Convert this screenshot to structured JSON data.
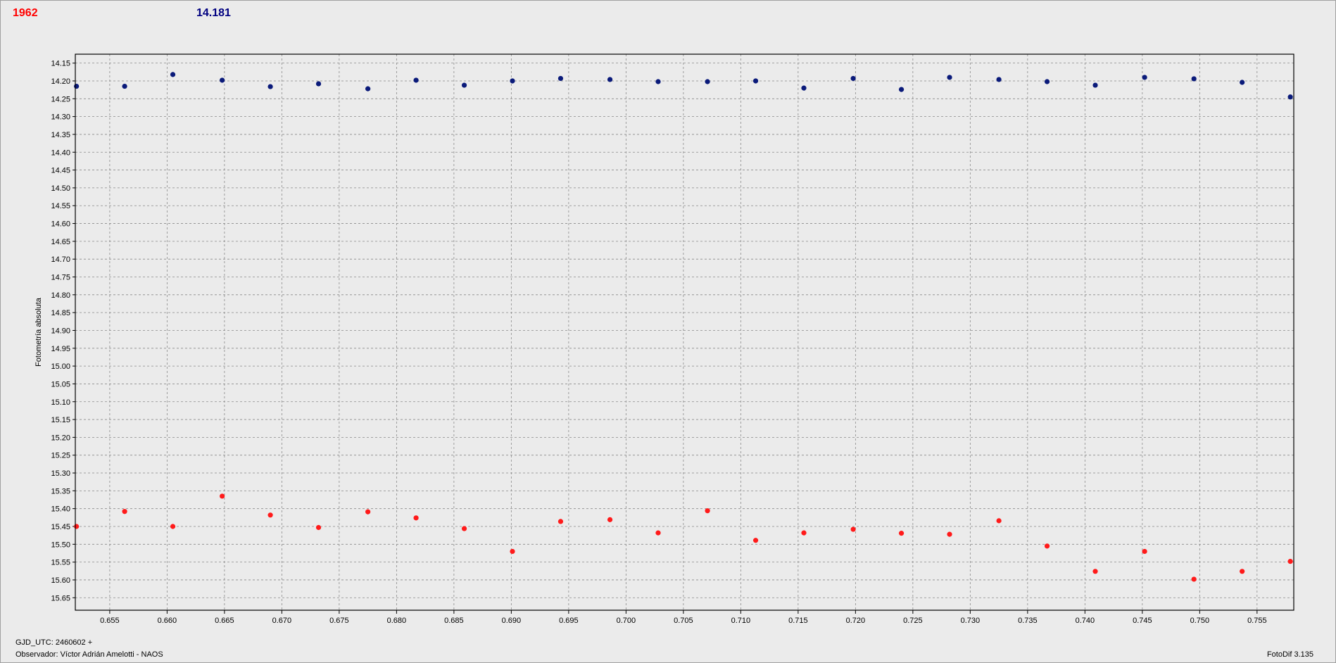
{
  "header": {
    "left_value": "1962",
    "right_value": "14.181"
  },
  "footer": {
    "gjd": "GJD_UTC: 2460602 +",
    "observer": "Observador: Víctor Adrián Amelotti - NAOS",
    "software": "FotoDif 3.135"
  },
  "colors": {
    "series_red": "#ff1a1a",
    "series_blue": "#0a1a7a",
    "header_red": "#ff0000",
    "header_blue": "#000080",
    "background": "#ebebeb",
    "grid": "#8a8a8a"
  },
  "chart_data": {
    "type": "scatter",
    "ylabel": "Fotometría absoluta",
    "xlabel": "",
    "xlim": [
      0.652,
      0.7582
    ],
    "ylim": [
      15.685,
      14.125
    ],
    "y_inverted": true,
    "grid": true,
    "x_ticks": [
      "0.655",
      "0.660",
      "0.665",
      "0.670",
      "0.675",
      "0.680",
      "0.685",
      "0.690",
      "0.695",
      "0.700",
      "0.705",
      "0.710",
      "0.715",
      "0.720",
      "0.725",
      "0.730",
      "0.735",
      "0.740",
      "0.745",
      "0.750",
      "0.755"
    ],
    "y_ticks": [
      "14.15",
      "14.20",
      "14.25",
      "14.30",
      "14.35",
      "14.40",
      "14.45",
      "14.50",
      "14.55",
      "14.60",
      "14.65",
      "14.70",
      "14.75",
      "14.80",
      "14.85",
      "14.90",
      "14.95",
      "15.00",
      "15.05",
      "15.10",
      "15.15",
      "15.20",
      "15.25",
      "15.30",
      "15.35",
      "15.40",
      "15.45",
      "15.50",
      "15.55",
      "15.60",
      "15.65"
    ],
    "x": [
      0.6521,
      0.6563,
      0.6605,
      0.6648,
      0.669,
      0.6732,
      0.6775,
      0.6817,
      0.6859,
      0.6901,
      0.6943,
      0.6986,
      0.7028,
      0.7071,
      0.7113,
      0.7155,
      0.7198,
      0.724,
      0.7282,
      0.7325,
      0.7367,
      0.7409,
      0.7452,
      0.7495,
      0.7537,
      0.7579
    ],
    "series": [
      {
        "color": "#0a1a7a",
        "values": [
          14.215,
          14.215,
          14.182,
          14.198,
          14.216,
          14.208,
          14.222,
          14.198,
          14.212,
          14.2,
          14.193,
          14.196,
          14.202,
          14.202,
          14.2,
          14.22,
          14.193,
          14.224,
          14.19,
          14.196,
          14.202,
          14.212,
          14.19,
          14.194,
          14.204,
          14.245
        ]
      },
      {
        "color": "#ff1a1a",
        "values": [
          15.45,
          15.408,
          15.45,
          15.365,
          15.418,
          15.453,
          15.409,
          15.426,
          15.456,
          15.52,
          15.436,
          15.431,
          15.468,
          15.406,
          15.489,
          15.468,
          15.458,
          15.469,
          15.472,
          15.434,
          15.505,
          15.576,
          15.52,
          15.598,
          15.576,
          15.548
        ]
      }
    ]
  }
}
